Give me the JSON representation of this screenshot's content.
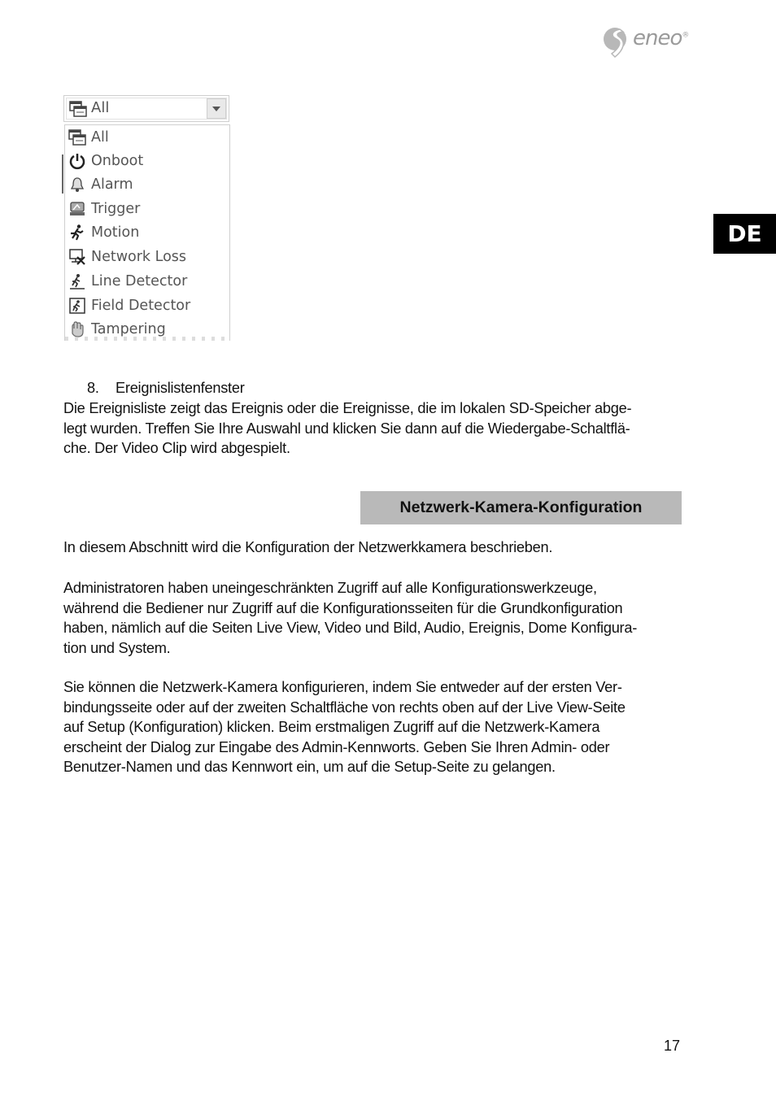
{
  "header": {
    "brand_logo_text": "eneo",
    "brand_registered_mark": "®",
    "language_tab": "DE"
  },
  "event_filter": {
    "selected_value": "All",
    "options": [
      {
        "label": "All",
        "icon": "event-list-icon"
      },
      {
        "label": "Onboot",
        "icon": "power-icon"
      },
      {
        "label": "Alarm",
        "icon": "bell-icon"
      },
      {
        "label": "Trigger",
        "icon": "trigger-icon"
      },
      {
        "label": "Motion",
        "icon": "running-person-icon"
      },
      {
        "label": "Network Loss",
        "icon": "network-loss-icon"
      },
      {
        "label": "Line Detector",
        "icon": "line-detector-icon"
      },
      {
        "label": "Field Detector",
        "icon": "field-detector-icon"
      },
      {
        "label": "Tampering",
        "icon": "hand-icon"
      }
    ]
  },
  "content": {
    "list_item_number": "8.",
    "list_item_title": "Ereignislistenfenster",
    "para_event_list": [
      "Die Ereignisliste zeigt das Ereignis oder die Ereignisse, die im lokalen SD-Speicher abge-",
      "legt wurden. Treffen Sie Ihre Auswahl und klicken Sie dann auf die Wiedergabe-Schaltflä-",
      "che. Der Video Clip wird abgespielt."
    ],
    "section_heading": "Netzwerk-Kamera-Konfiguration",
    "para_intro": [
      "In diesem Abschnitt wird die Konfiguration der Netzwerkkamera beschrieben."
    ],
    "para_admin": [
      "Administratoren haben uneingeschränkten Zugriff auf alle Konfigurationswerkzeuge,",
      "während die Bediener nur Zugriff auf die Konfigurationsseiten für die Grundkonfiguration",
      "haben, nämlich auf die Seiten Live View, Video und Bild, Audio, Ereignis, Dome Konfigura-",
      "tion und System."
    ],
    "para_setup": [
      "Sie können die Netzwerk-Kamera konfigurieren, indem Sie entweder auf der ersten Ver-",
      "bindungsseite oder auf der zweiten Schaltfläche von rechts oben auf der Live View-Seite",
      "auf Setup (Konfiguration) klicken. Beim erstmaligen Zugriff auf die Netzwerk-Kamera",
      "erscheint der Dialog zur Eingabe des Admin-Kennworts. Geben Sie Ihren Admin- oder",
      "Benutzer-Namen und das Kennwort ein, um auf die Setup-Seite zu gelangen."
    ]
  },
  "footer": {
    "page_number": "17"
  }
}
